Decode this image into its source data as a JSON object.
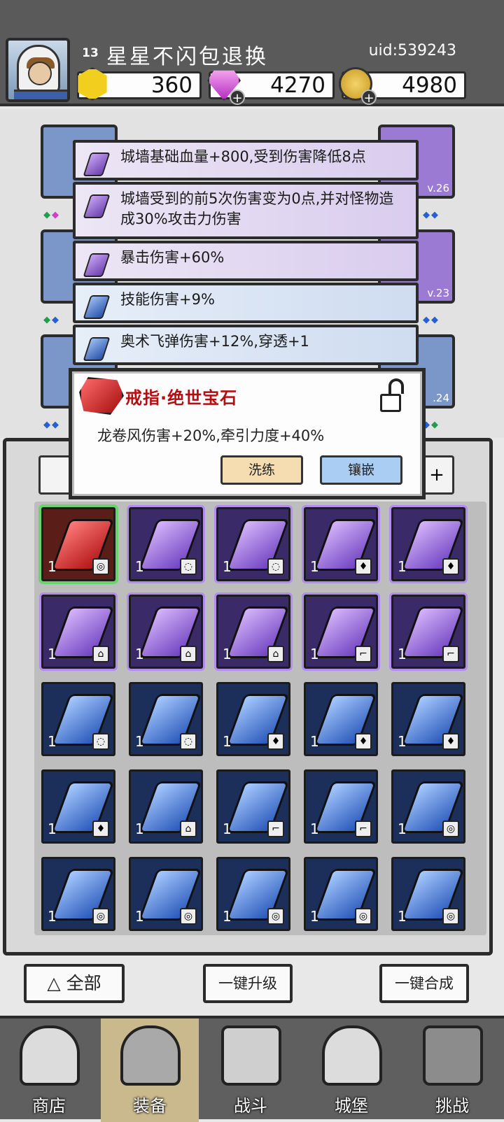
{
  "player": {
    "level": "13",
    "name": "星星不闪包退换",
    "uid": "uid:539243"
  },
  "resources": [
    {
      "icon": "topaz-icon",
      "value": "360"
    },
    {
      "icon": "gem-icon",
      "value": "4270"
    },
    {
      "icon": "coin-icon",
      "value": "4980"
    }
  ],
  "equipment_levels": [
    "v.26",
    "v.23",
    ".24"
  ],
  "gem_stats": [
    {
      "text": "城墙基础血量+800,受到伤害降低8点",
      "tier": "purple"
    },
    {
      "text": "城墙受到的前5次伤害变为0点,并对怪物造成30%攻击力伤害",
      "tier": "purple"
    },
    {
      "text": "暴击伤害+60%",
      "tier": "purple"
    },
    {
      "text": "技能伤害+9%",
      "tier": "blue"
    },
    {
      "text": "奥术飞弹伤害+12%,穿透+1",
      "tier": "blue"
    }
  ],
  "detail": {
    "title": "戒指·绝世宝石",
    "effect": "龙卷风伤害+20%,牵引力度+40%",
    "reroll_label": "洗练",
    "inlay_label": "镶嵌"
  },
  "panel": {
    "plus_label": "+"
  },
  "gems": [
    {
      "tier": "red",
      "count": "1"
    },
    {
      "tier": "purple",
      "count": "1"
    },
    {
      "tier": "purple",
      "count": "1"
    },
    {
      "tier": "purple",
      "count": "1"
    },
    {
      "tier": "purple",
      "count": "1"
    },
    {
      "tier": "purple",
      "count": "1"
    },
    {
      "tier": "purple",
      "count": "1"
    },
    {
      "tier": "purple",
      "count": "1"
    },
    {
      "tier": "purple",
      "count": "1"
    },
    {
      "tier": "purple",
      "count": "1"
    },
    {
      "tier": "blue",
      "count": "1"
    },
    {
      "tier": "blue",
      "count": "1"
    },
    {
      "tier": "blue",
      "count": "1"
    },
    {
      "tier": "blue",
      "count": "1"
    },
    {
      "tier": "blue",
      "count": "1"
    },
    {
      "tier": "blue",
      "count": "1"
    },
    {
      "tier": "blue",
      "count": "1"
    },
    {
      "tier": "blue",
      "count": "1"
    },
    {
      "tier": "blue",
      "count": "1"
    },
    {
      "tier": "blue",
      "count": "1"
    },
    {
      "tier": "blue",
      "count": "1"
    },
    {
      "tier": "blue",
      "count": "1"
    },
    {
      "tier": "blue",
      "count": "1"
    },
    {
      "tier": "blue",
      "count": "1"
    },
    {
      "tier": "blue",
      "count": "1"
    }
  ],
  "actions": {
    "filter_all": "全部",
    "upgrade_all": "一键升级",
    "merge_all": "一键合成"
  },
  "nav": {
    "shop": "商店",
    "equipment": "装备",
    "battle": "战斗",
    "castle": "城堡",
    "challenge": "挑战"
  },
  "colors": {
    "topbar": "#5a5a5a",
    "red_gem": "#b01313",
    "purple_gem": "#6d3fc0",
    "blue_gem": "#2454b8",
    "title_red": "#b30e12"
  }
}
